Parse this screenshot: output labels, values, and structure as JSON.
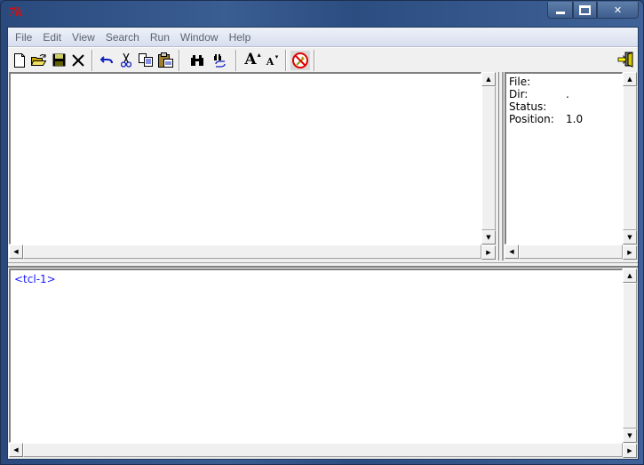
{
  "window": {
    "app_icon_text": "7k",
    "controls": {
      "minimize": "minimize",
      "maximize": "maximize",
      "close": "✕"
    }
  },
  "menubar": {
    "items": [
      "File",
      "Edit",
      "View",
      "Search",
      "Run",
      "Window",
      "Help"
    ]
  },
  "toolbar": {
    "icons": {
      "new": "🗋",
      "open": "📂",
      "save": "💾",
      "close": "✕",
      "undo": "↶",
      "cut": "✂",
      "copy": "⎘",
      "paste": "📋",
      "find": "🔍",
      "replace": "⇄",
      "font_bigger": "A",
      "font_smaller": "A",
      "stop": "⊘",
      "exit": "🚪"
    }
  },
  "info_panel": {
    "rows": [
      {
        "label": "File:",
        "value": ""
      },
      {
        "label": "Dir:",
        "value": "."
      },
      {
        "label": "Status:",
        "value": ""
      },
      {
        "label": "Position:",
        "value": "1.0"
      }
    ]
  },
  "console": {
    "prompt": "<tcl-1>"
  },
  "scrollbars": {
    "up_arrow": "▲",
    "down_arrow": "▼",
    "left_arrow": "◀",
    "right_arrow": "▶"
  }
}
